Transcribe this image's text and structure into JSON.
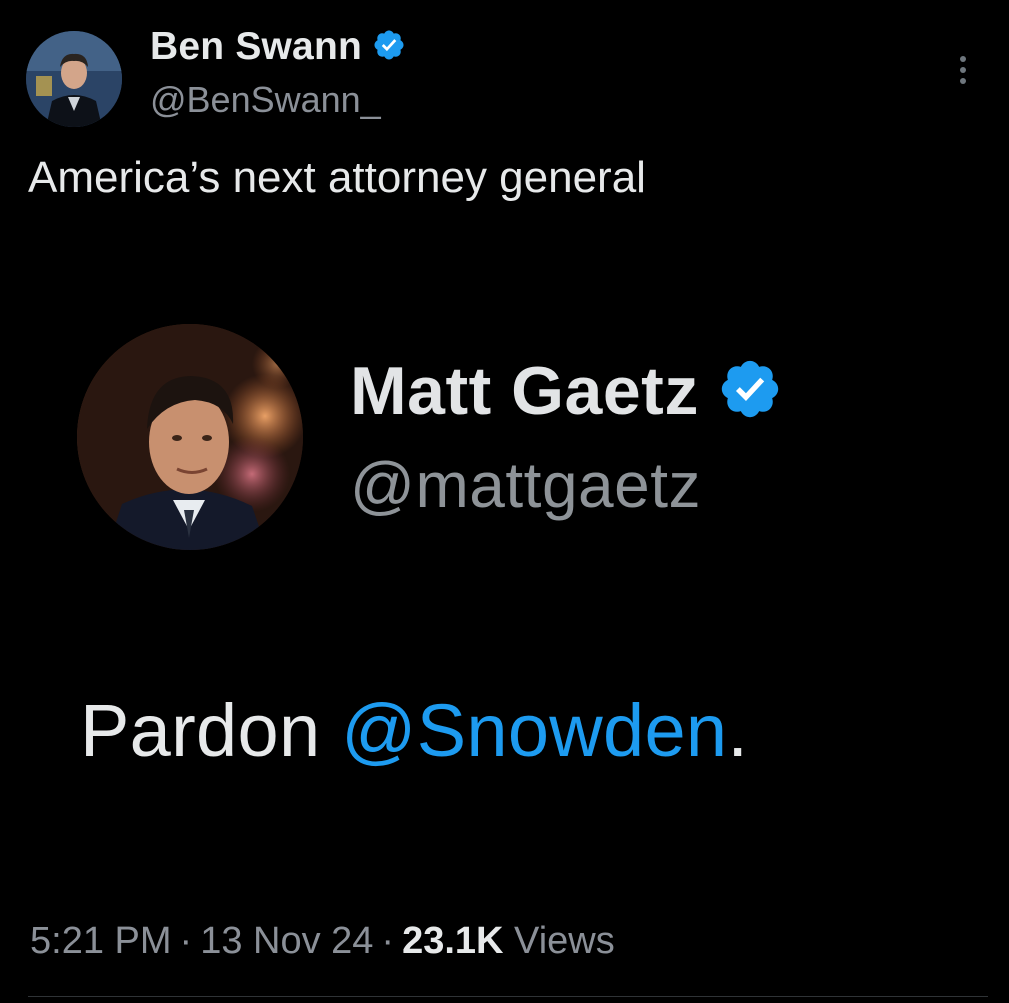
{
  "author": {
    "name": "Ben Swann",
    "handle": "@BenSwann_",
    "verified": true
  },
  "tweet": {
    "text": "America’s next attorney general"
  },
  "embedded_post": {
    "name": "Matt Gaetz",
    "handle": "@mattgaetz",
    "verified": true,
    "text_prefix": "Pardon ",
    "mention": "@Snowden",
    "text_suffix": "."
  },
  "meta": {
    "time": "5:21 PM",
    "separator": "·",
    "date": "13 Nov 24",
    "views_count": "23.1K",
    "views_label": "Views"
  },
  "icons": {
    "verified": "verified-badge-icon",
    "more": "more-options-icon"
  },
  "colors": {
    "background": "#000000",
    "text_primary": "#e7e9ea",
    "text_secondary": "#8b9098",
    "accent": "#1d9bf0"
  }
}
